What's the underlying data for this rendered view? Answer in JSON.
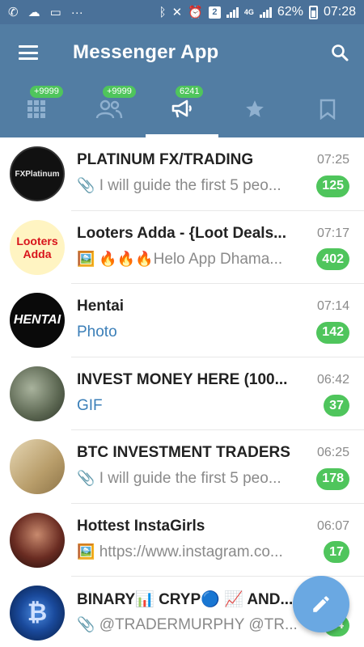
{
  "status_bar": {
    "left_icons": [
      "whatsapp-icon",
      "ghost-icon",
      "message-icon",
      "more-icon"
    ],
    "sim_badge": "2",
    "network": "4G",
    "battery": "62%",
    "time": "07:28"
  },
  "app_bar": {
    "title": "Messenger App",
    "menu_icon": "hamburger-menu-icon",
    "search_icon": "search-icon"
  },
  "tabs": [
    {
      "icon": "grid-icon",
      "badge": "+9999",
      "active": false
    },
    {
      "icon": "people-icon",
      "badge": "+9999",
      "active": false
    },
    {
      "icon": "megaphone-icon",
      "badge": "6241",
      "active": true
    },
    {
      "icon": "star-icon",
      "badge": "",
      "active": false
    },
    {
      "icon": "bookmark-icon",
      "badge": "",
      "active": false
    }
  ],
  "chats": [
    {
      "name": "PLATINUM FX/TRADING",
      "time": "07:25",
      "prefix": "📎",
      "preview": "I will guide the first 5 peo...",
      "count": "125",
      "avatar_text": "FXPlatinum",
      "avatar_bg": "#111111"
    },
    {
      "name": "Looters Adda - {Loot Deals...",
      "time": "07:17",
      "prefix": "🖼️ 🔥🔥🔥",
      "preview": "Helo App Dhama...",
      "count": "402",
      "avatar_text": "Looters Adda",
      "avatar_bg": "#fff4c2"
    },
    {
      "name": "Hentai",
      "time": "07:14",
      "prefix": "",
      "preview": "Photo",
      "count": "142",
      "avatar_text": "HENTAI",
      "avatar_bg": "#0a0a0a"
    },
    {
      "name": "INVEST MONEY HERE (100...",
      "time": "06:42",
      "prefix": "",
      "preview": "GIF",
      "count": "37",
      "avatar_text": "",
      "avatar_bg": "#6e7b6a"
    },
    {
      "name": "BTC INVESTMENT TRADERS",
      "time": "06:25",
      "prefix": "📎",
      "preview": "I will guide the first 5 peo...",
      "count": "178",
      "avatar_text": "",
      "avatar_bg": "#c9b48a"
    },
    {
      "name": "Hottest InstaGirls",
      "time": "06:07",
      "prefix": "🖼️",
      "preview": "https://www.instagram.co...",
      "count": "17",
      "avatar_text": "",
      "avatar_bg": "#3a1a14"
    },
    {
      "name": "BINARY📊 CRYP🔵 📈 AND...",
      "time": "",
      "prefix": "📎",
      "preview": "@TRADERMURPHY @TR...",
      "count": "14",
      "avatar_text": "",
      "avatar_bg": "#0d2a5c"
    }
  ],
  "fab": {
    "icon": "pencil-compose-icon"
  },
  "colors": {
    "status_bar": "#4a7199",
    "app_bar": "#527da3",
    "badge_green": "#4fc55c",
    "fab": "#6aa8e2",
    "link_blue": "#3b7fb8"
  }
}
